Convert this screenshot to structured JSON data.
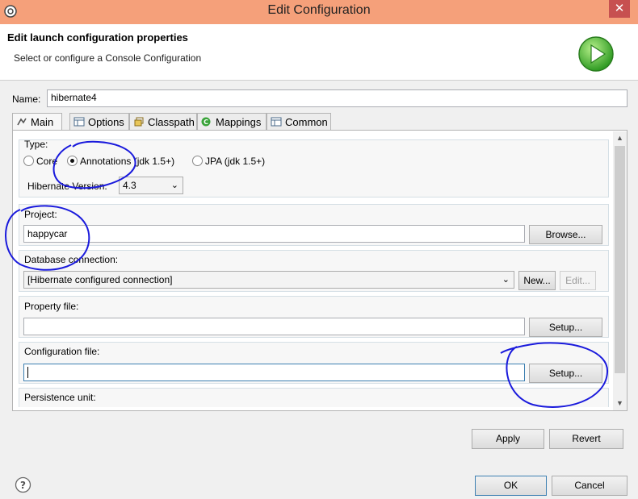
{
  "window": {
    "title": "Edit Configuration",
    "close_label": "✕"
  },
  "header": {
    "title": "Edit launch configuration properties",
    "subtitle": "Select or configure a Console Configuration"
  },
  "name_field": {
    "label": "Name:",
    "value": "hibernate4"
  },
  "tabs": [
    {
      "label": "Main",
      "icon": "main-tab-icon",
      "active": true
    },
    {
      "label": "Options",
      "icon": "table-icon"
    },
    {
      "label": "Classpath",
      "icon": "classpath-icon"
    },
    {
      "label": "Mappings",
      "icon": "mappings-icon"
    },
    {
      "label": "Common",
      "icon": "table-icon"
    }
  ],
  "main": {
    "type": {
      "label": "Type:",
      "options": [
        {
          "label": "Core",
          "selected": false
        },
        {
          "label": "Annotations (jdk 1.5+)",
          "selected": true
        },
        {
          "label": "JPA (jdk 1.5+)",
          "selected": false
        }
      ],
      "version_label": "Hibernate Version:",
      "version_value": "4.3",
      "version_arrow": "⌄"
    },
    "project": {
      "label": "Project:",
      "value": "happycar",
      "browse_label": "Browse..."
    },
    "database": {
      "label": "Database connection:",
      "value": "[Hibernate configured connection]",
      "arrow": "⌄",
      "new_label": "New...",
      "edit_label": "Edit..."
    },
    "property_file": {
      "label": "Property file:",
      "value": "",
      "setup_label": "Setup..."
    },
    "configuration_file": {
      "label": "Configuration file:",
      "value": "",
      "setup_label": "Setup..."
    },
    "persistence_unit": {
      "label": "Persistence unit:"
    }
  },
  "scrollbar": {
    "up_glyph": "▲",
    "down_glyph": "▼"
  },
  "buttons": {
    "apply": "Apply",
    "revert": "Revert",
    "ok": "OK",
    "cancel": "Cancel"
  },
  "colors": {
    "titlebar": "#f5a07a",
    "annotation_ink": "#1a1adc",
    "focus_border": "#3c7fb1"
  }
}
